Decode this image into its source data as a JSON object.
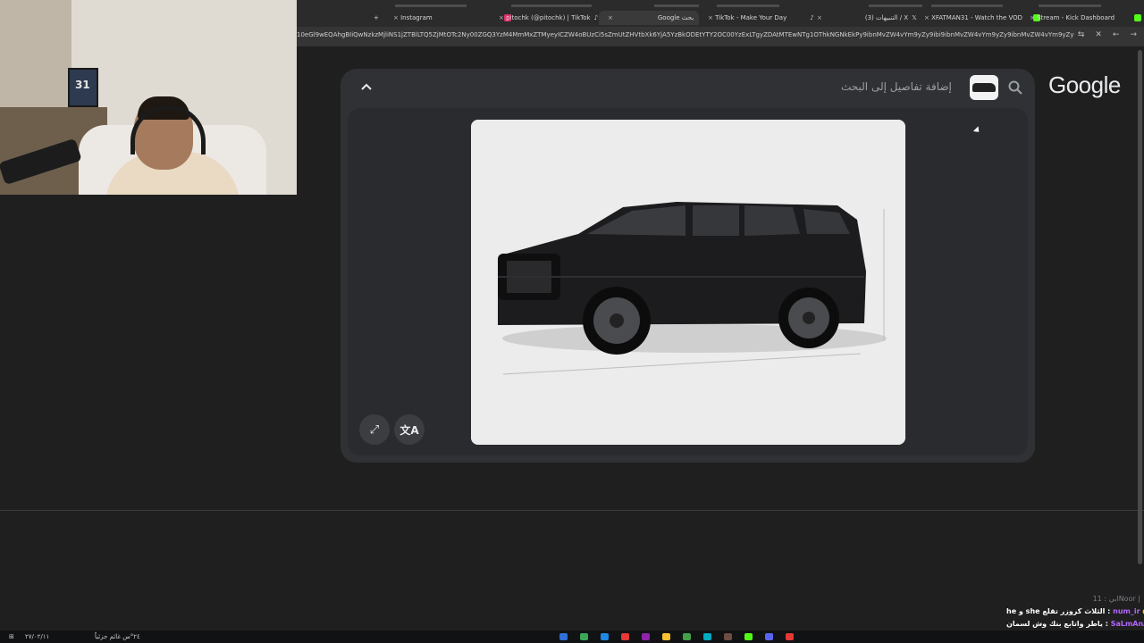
{
  "browser": {
    "tabs": [
      {
        "label": "Instagram",
        "icon_color": "#e1306c"
      },
      {
        "label": "pitochk (@pitochk) | TikTok",
        "icon_color": "#ffffff"
      },
      {
        "label": "Google بحث",
        "icon_color": "#9aa0a6",
        "active": true
      },
      {
        "label": "TikTok - Make Your Day",
        "icon_color": "#ffffff"
      },
      {
        "label": "(3) التنبيهات / X",
        "icon_color": "#ffffff"
      },
      {
        "label": "XFATMAN31 - Watch the VOD",
        "icon_color": "#53fc18"
      },
      {
        "label": "Stream - Kick Dashboard",
        "icon_color": "#53fc18"
      }
    ],
    "url": "10eGl9wEQAhgBIiQwNzkzMjliNS1jZTBlLTQ5ZjMtOTc2Ny00ZGQ3YzM4MmMxZTMyeyICZW4oBUzCi5sZmUtZHVtbXk6YjA5YzBkODEtYTY2OC00YzExLTgyZDAtMTEwNTg1OThkNGNkEkPy9ibnMvZW4vYm9yZy9ibi9ibnMvZW4vYm9yZy9ibnMvZW4vYm9yZy9ibnMvZW4vYm9yZy9ibnMvZW4vYm9yZy9ibnMvZW4vYm9yZy9ibnMvZW4vYm9yZy9ibnMvZW5...",
    "webcam_label": "31"
  },
  "lens": {
    "logo": "Google",
    "search_placeholder": "إضافة تفاصيل إلى البحث",
    "chevron_icon": "chevron-up-icon",
    "expand_icon": "expand-icon",
    "translate_icon": "translate-icon",
    "image_subject": "black SUV"
  },
  "chat": {
    "faded_line": "ابي : 11Noor |",
    "lines": [
      {
        "user": "num_ir",
        "separator": " : ",
        "message": "he و she الثلاث كروزر تقلع"
      },
      {
        "user": "SaLmAnAlSubaie",
        "separator": " : ",
        "message": "ياطر واتابع بنك وش لسمان"
      }
    ]
  },
  "taskbar": {
    "left_text": "٢٧/٠٢/١١",
    "weather_text": "٢٤°س غائم جزئياً"
  },
  "colors": {
    "background": "#1f1f1f",
    "panel": "#303134",
    "accent_kick": "#53fc18"
  }
}
